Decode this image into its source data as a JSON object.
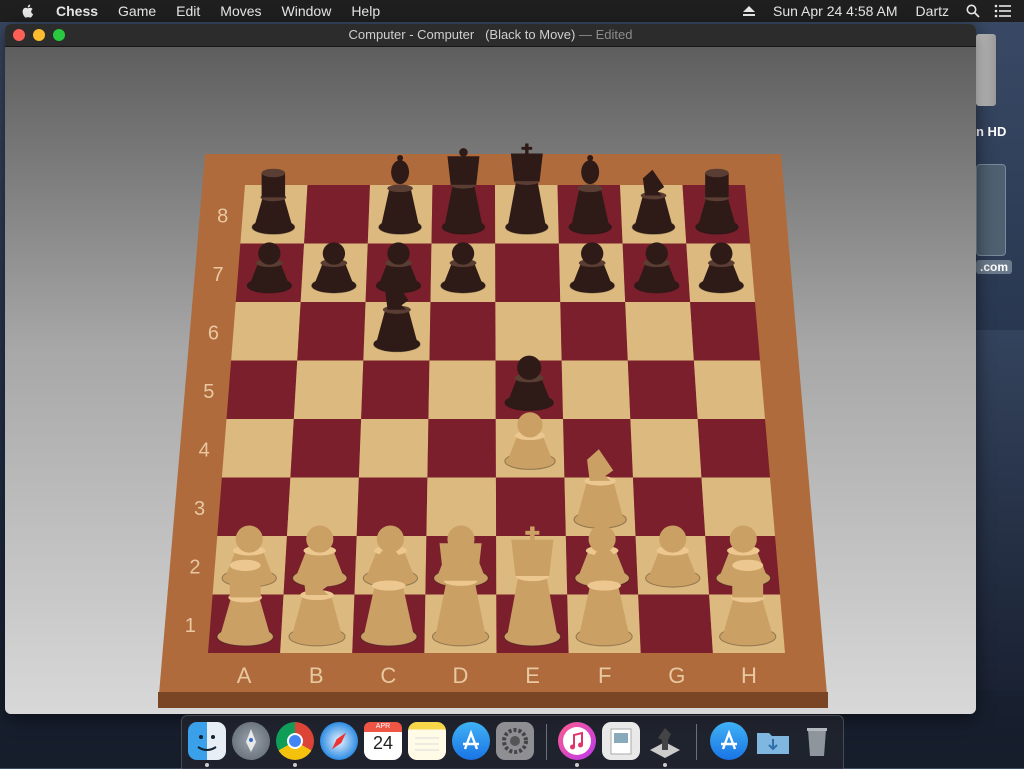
{
  "menubar": {
    "app_name": "Chess",
    "menus": [
      "Game",
      "Edit",
      "Moves",
      "Window",
      "Help"
    ],
    "clock": "Sun Apr 24  4:58 AM",
    "user": "Dartz",
    "icons": [
      "apple-icon",
      "eject-icon",
      "spotlight-search-icon",
      "notification-center-icon"
    ]
  },
  "desktop": {
    "drive_label": "n HD",
    "domain_label": ".com"
  },
  "window": {
    "title": "Computer - Computer",
    "status": "(Black to Move)",
    "edited": "— Edited"
  },
  "board": {
    "files": [
      "A",
      "B",
      "C",
      "D",
      "E",
      "F",
      "G",
      "H"
    ],
    "ranks": [
      "8",
      "7",
      "6",
      "5",
      "4",
      "3",
      "2",
      "1"
    ],
    "pieces": [
      {
        "sq": "a8",
        "type": "rook",
        "color": "black"
      },
      {
        "sq": "c8",
        "type": "bishop",
        "color": "black"
      },
      {
        "sq": "d8",
        "type": "queen",
        "color": "black"
      },
      {
        "sq": "e8",
        "type": "king",
        "color": "black"
      },
      {
        "sq": "f8",
        "type": "bishop",
        "color": "black"
      },
      {
        "sq": "g8",
        "type": "knight",
        "color": "black"
      },
      {
        "sq": "h8",
        "type": "rook",
        "color": "black"
      },
      {
        "sq": "a7",
        "type": "pawn",
        "color": "black"
      },
      {
        "sq": "b7",
        "type": "pawn",
        "color": "black"
      },
      {
        "sq": "c7",
        "type": "pawn",
        "color": "black"
      },
      {
        "sq": "d7",
        "type": "pawn",
        "color": "black"
      },
      {
        "sq": "f7",
        "type": "pawn",
        "color": "black"
      },
      {
        "sq": "g7",
        "type": "pawn",
        "color": "black"
      },
      {
        "sq": "h7",
        "type": "pawn",
        "color": "black"
      },
      {
        "sq": "c6",
        "type": "knight",
        "color": "black"
      },
      {
        "sq": "e5",
        "type": "pawn",
        "color": "black"
      },
      {
        "sq": "e4",
        "type": "pawn",
        "color": "white"
      },
      {
        "sq": "f3",
        "type": "knight",
        "color": "white"
      },
      {
        "sq": "a2",
        "type": "pawn",
        "color": "white"
      },
      {
        "sq": "b2",
        "type": "pawn",
        "color": "white"
      },
      {
        "sq": "c2",
        "type": "pawn",
        "color": "white"
      },
      {
        "sq": "d2",
        "type": "pawn",
        "color": "white"
      },
      {
        "sq": "f2",
        "type": "pawn",
        "color": "white"
      },
      {
        "sq": "g2",
        "type": "pawn",
        "color": "white"
      },
      {
        "sq": "h2",
        "type": "pawn",
        "color": "white"
      },
      {
        "sq": "a1",
        "type": "rook",
        "color": "white"
      },
      {
        "sq": "b1",
        "type": "knight",
        "color": "white"
      },
      {
        "sq": "c1",
        "type": "bishop",
        "color": "white"
      },
      {
        "sq": "d1",
        "type": "queen",
        "color": "white"
      },
      {
        "sq": "e1",
        "type": "king",
        "color": "white"
      },
      {
        "sq": "f1",
        "type": "bishop",
        "color": "white"
      },
      {
        "sq": "h1",
        "type": "rook",
        "color": "white"
      }
    ],
    "colors": {
      "dark_square": "#7a1f2b",
      "light_square": "#dcb97e",
      "frame": "#b06b3c",
      "frame_edge": "#7a4524",
      "black_piece": "#2e1a16",
      "white_piece": "#caa064"
    }
  },
  "dock": {
    "apps": [
      {
        "name": "finder-icon",
        "running": true
      },
      {
        "name": "launchpad-icon",
        "running": false
      },
      {
        "name": "chrome-icon",
        "running": true
      },
      {
        "name": "safari-icon",
        "running": false
      },
      {
        "name": "calendar-icon",
        "running": false,
        "month": "APR",
        "day": "24"
      },
      {
        "name": "notes-icon",
        "running": false
      },
      {
        "name": "app-store-icon",
        "running": false
      },
      {
        "name": "system-preferences-icon",
        "running": false
      },
      {
        "name": "itunes-icon",
        "running": true
      },
      {
        "name": "preview-icon",
        "running": false
      },
      {
        "name": "chess-icon",
        "running": true
      },
      {
        "name": "app-store-downloads-icon",
        "running": false
      },
      {
        "name": "downloads-folder-icon",
        "running": false
      },
      {
        "name": "trash-icon",
        "running": false
      }
    ]
  }
}
